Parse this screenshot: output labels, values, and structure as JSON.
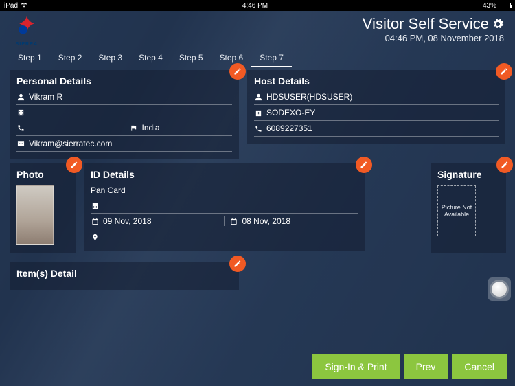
{
  "statusbar": {
    "device": "iPad",
    "time": "4:46 PM",
    "battery_pct": "43%"
  },
  "logo": {
    "text": "SIERRA"
  },
  "header": {
    "title": "Visitor Self Service",
    "datetime": "04:46 PM, 08 November 2018"
  },
  "steps": [
    {
      "label": "Step 1",
      "active": false
    },
    {
      "label": "Step 2",
      "active": false
    },
    {
      "label": "Step 3",
      "active": false
    },
    {
      "label": "Step 4",
      "active": false
    },
    {
      "label": "Step 5",
      "active": false
    },
    {
      "label": "Step 6",
      "active": false
    },
    {
      "label": "Step 7",
      "active": true
    }
  ],
  "personal": {
    "title": "Personal Details",
    "name": "Vikram R",
    "company": "",
    "phone": "",
    "country": "India",
    "email": "Vikram@sierratec.com"
  },
  "host": {
    "title": "Host Details",
    "name": "HDSUSER(HDSUSER)",
    "company": "SODEXO-EY",
    "phone": "6089227351"
  },
  "photo": {
    "title": "Photo"
  },
  "id": {
    "title": "ID Details",
    "type": "Pan Card",
    "number": "",
    "issue_date": "09 Nov, 2018",
    "expiry_date": "08 Nov, 2018",
    "place": ""
  },
  "signature": {
    "title": "Signature",
    "placeholder": "Picture Not Available"
  },
  "items": {
    "title": "Item(s) Detail"
  },
  "footer": {
    "signin": "Sign-In & Print",
    "prev": "Prev",
    "cancel": "Cancel"
  }
}
